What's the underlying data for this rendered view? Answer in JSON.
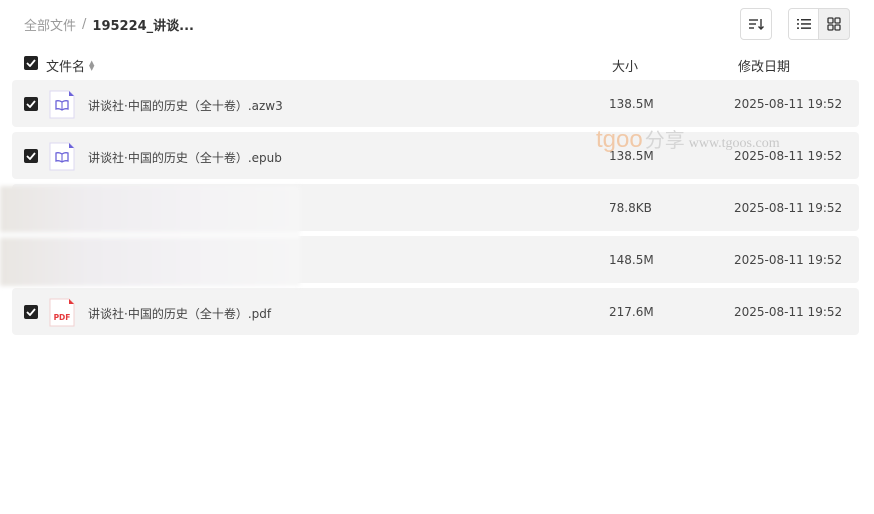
{
  "breadcrumb": {
    "root": "全部文件",
    "separator": "/",
    "current": "195224_讲谈..."
  },
  "toolbar": {
    "sort_icon": "sort-descending-icon",
    "list_icon": "list-view-icon",
    "grid_icon": "grid-view-icon",
    "active_view": "grid"
  },
  "columns": {
    "name": "文件名",
    "size": "大小",
    "date": "修改日期"
  },
  "files": [
    {
      "name": "讲谈社·中国的历史（全十卷）.azw3",
      "size": "138.5M",
      "date": "2025-08-11 19:52",
      "icon": "ebook-icon",
      "checked": true
    },
    {
      "name": "讲谈社·中国的历史（全十卷）.epub",
      "size": "138.5M",
      "date": "2025-08-11 19:52",
      "icon": "ebook-icon",
      "checked": true
    },
    {
      "name": "",
      "size": "78.8KB",
      "date": "2025-08-11 19:52",
      "icon": "",
      "checked": false
    },
    {
      "name": "",
      "size": "148.5M",
      "date": "2025-08-11 19:52",
      "icon": "",
      "checked": false
    },
    {
      "name": "讲谈社·中国的历史（全十卷）.pdf",
      "size": "217.6M",
      "date": "2025-08-11 19:52",
      "icon": "pdf-icon",
      "checked": true
    }
  ],
  "watermark": {
    "logo": "tgoo",
    "cn": "分享",
    "url": "www.tgoos.com"
  },
  "colors": {
    "row_bg": "#f3f3f3",
    "checkbox": "#222222",
    "ebook_icon": "#6c63d9",
    "pdf_icon": "#e5383b"
  }
}
